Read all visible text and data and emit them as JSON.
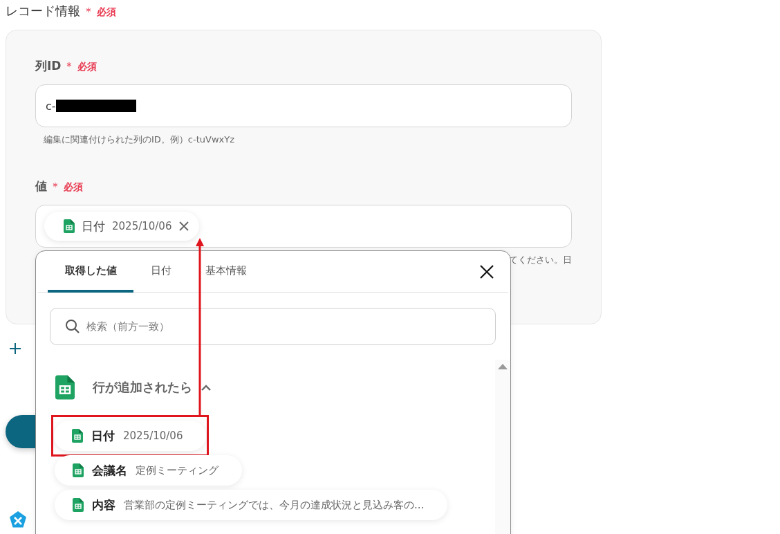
{
  "section": {
    "title": "レコード情報",
    "required_mark": "＊",
    "required_label": "必須"
  },
  "fields": [
    {
      "label": "列ID",
      "required_mark": "＊",
      "required_label": "必須",
      "kind": "text",
      "value": "c-",
      "redacted": true,
      "hint": "編集に関連付けられた列のID。例）c-tuVwxYz"
    },
    {
      "label": "値",
      "required_mark": "＊",
      "required_label": "必須",
      "kind": "chip",
      "chip": {
        "name": "日付",
        "value": "2025/10/06"
      },
      "hint": "てください。日"
    }
  ],
  "popover": {
    "tabs": [
      {
        "label": "取得した値",
        "selected": true
      },
      {
        "label": "日付",
        "selected": false
      },
      {
        "label": "基本情報",
        "selected": false
      }
    ],
    "search": {
      "placeholder": "検索（前方一致）"
    },
    "groups": [
      {
        "title": "行が追加されたら",
        "expanded": true,
        "items": [
          {
            "name": "日付",
            "value": "2025/10/06",
            "highlighted": true
          },
          {
            "name": "会議名",
            "value": "定例ミーティング",
            "highlighted": false
          },
          {
            "name": "内容",
            "value": "営業部の定例ミーティングでは、今月の達成状況と見込み客の...",
            "highlighted": false
          }
        ]
      }
    ]
  }
}
